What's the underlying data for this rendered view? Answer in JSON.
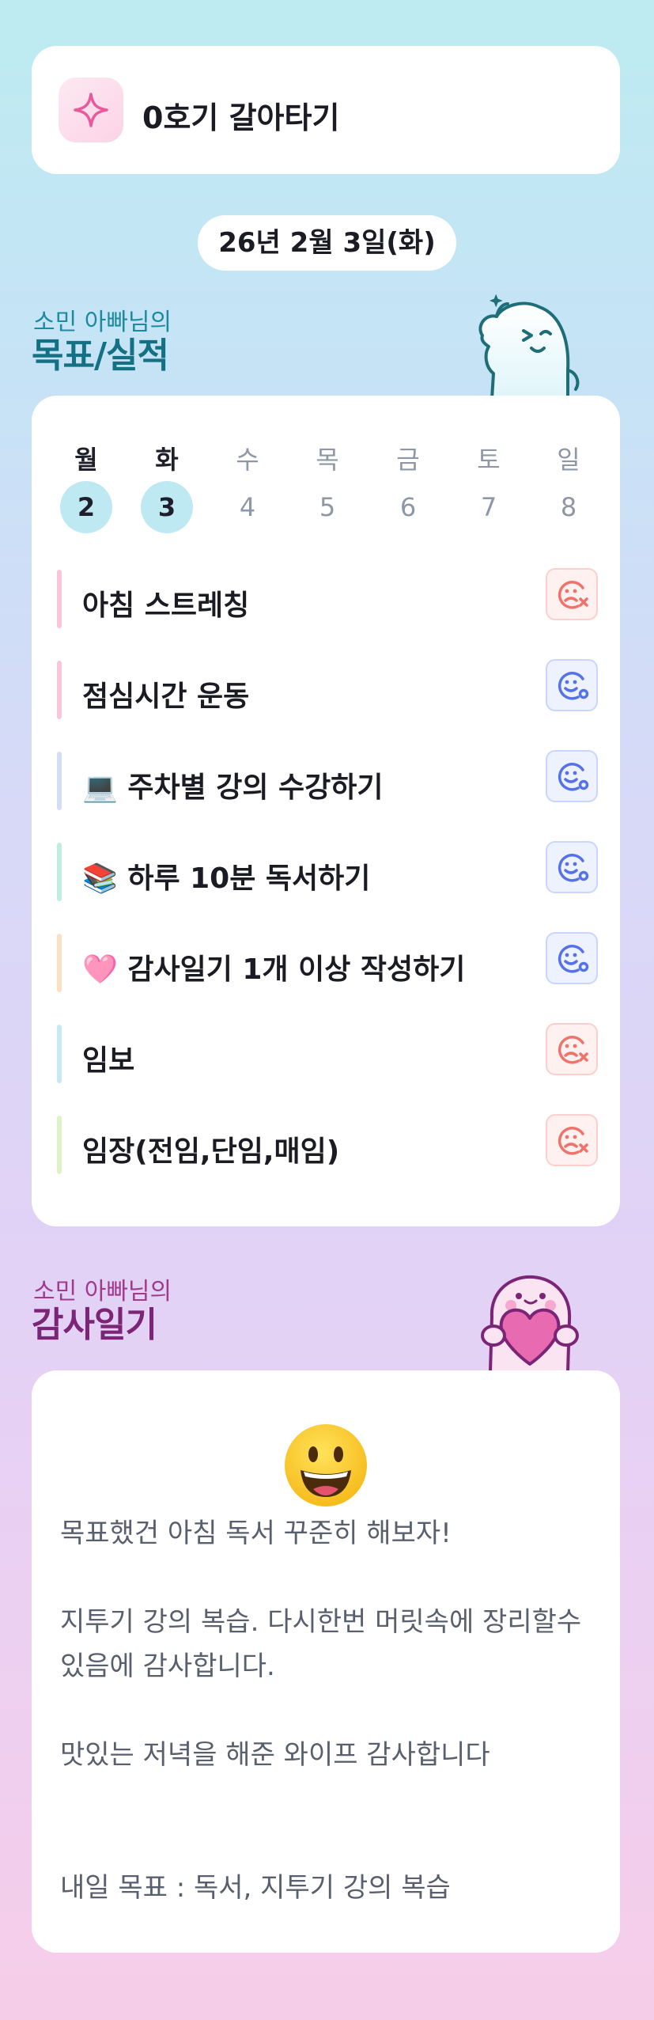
{
  "app": {
    "title": "0호기 갈아타기",
    "icon": "sparkle-icon"
  },
  "date": "26년 2월 3일(화)",
  "goals_section": {
    "subtitle": "소민 아빠님의",
    "title": "목표/실적"
  },
  "week": {
    "days": [
      "월",
      "화",
      "수",
      "목",
      "금",
      "토",
      "일"
    ],
    "dates": [
      "2",
      "3",
      "4",
      "5",
      "6",
      "7",
      "8"
    ],
    "active": [
      0,
      1
    ]
  },
  "goals": [
    {
      "label": "아침 스트레칭",
      "bar_color": "#f7c6dd",
      "status": "fail",
      "status_icon": "sad-x-face-icon"
    },
    {
      "label": "점심시간 운동",
      "bar_color": "#f7c6dd",
      "status": "done",
      "status_icon": "smile-check-face-icon"
    },
    {
      "label": "💻 주차별 강의 수강하기",
      "bar_color": "#d5dcf7",
      "status": "done",
      "status_icon": "smile-check-face-icon"
    },
    {
      "label": "📚 하루 10분 독서하기",
      "bar_color": "#bfeee0",
      "status": "done",
      "status_icon": "smile-check-face-icon"
    },
    {
      "label": "🩷 감사일기 1개 이상 작성하기",
      "bar_color": "#fde0c2",
      "status": "done",
      "status_icon": "smile-check-face-icon"
    },
    {
      "label": "임보",
      "bar_color": "#c6eaf4",
      "status": "fail",
      "status_icon": "sad-x-face-icon"
    },
    {
      "label": "임장(전임,단임,매임)",
      "bar_color": "#dff3c6",
      "status": "fail",
      "status_icon": "sad-x-face-icon"
    }
  ],
  "diary_section": {
    "subtitle": "소민 아빠님의",
    "title": "감사일기"
  },
  "diary": {
    "emoji": "grinning-face-emoji",
    "text": "목표했건 아침 독서 꾸준히 해보자!\n\n지투기 강의 복습. 다시한번 머릿속에 장리할수 있음에 감사합니다.\n\n맛있는 저녁을 해준 와이프 감사합니다\n\n\n내일 목표 : 독서, 지투기 강의 복습"
  },
  "colors": {
    "fail": "#f0736b",
    "done": "#5572e8",
    "goal_title": "#137183",
    "diary_title": "#7c2475"
  }
}
